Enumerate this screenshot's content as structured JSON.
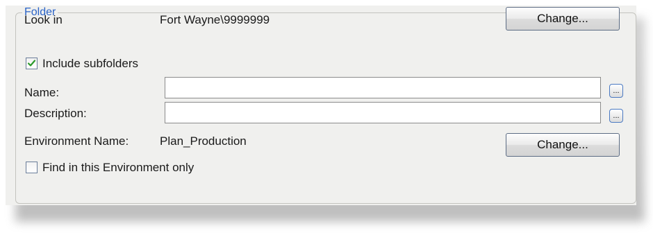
{
  "folder_group": {
    "legend": "Folder",
    "look_in_label": "Look in",
    "look_in_value": "Fort Wayne\\9999999",
    "change_button_1": "Change...",
    "include_subfolders_label": "Include subfolders",
    "include_subfolders_checked": true,
    "name_label": "Name:",
    "name_value": "",
    "name_browse_label": "...",
    "description_label": "Description:",
    "description_value": "",
    "description_browse_label": "...",
    "environment_label": "Environment Name:",
    "environment_value": "Plan_Production",
    "change_button_2": "Change...",
    "find_in_env_label": "Find in this Environment only",
    "find_in_env_checked": false
  },
  "colors": {
    "legend_text": "#2a63c7",
    "checkmark": "#2a9a2a",
    "panel_bg": "#f0f0ee"
  },
  "icons": {
    "checked": "checkmark-icon"
  }
}
